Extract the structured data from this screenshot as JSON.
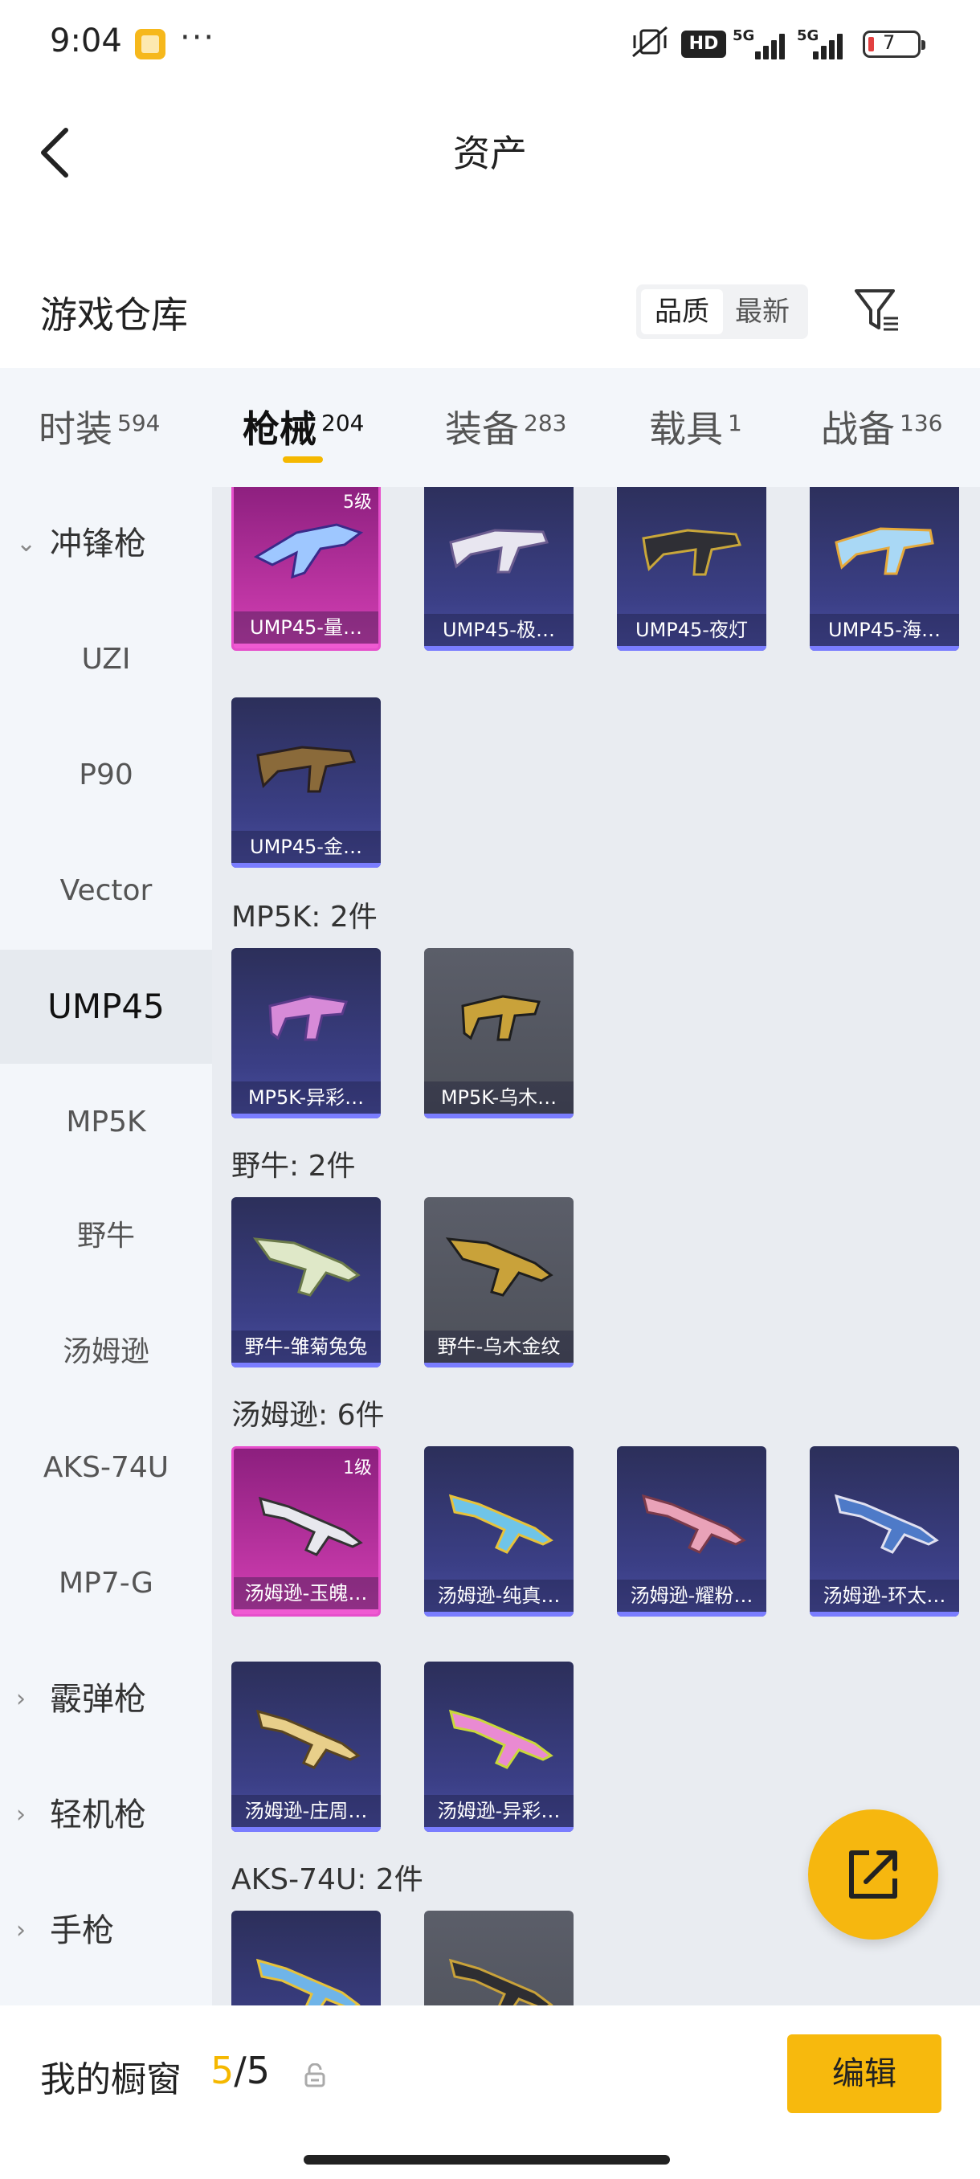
{
  "status_bar": {
    "time": "9:04",
    "battery": "7",
    "hd_label": "HD",
    "network1": "5G",
    "network2": "5G"
  },
  "header": {
    "title": "资产"
  },
  "warehouse": {
    "title": "游戏仓库",
    "sort_options": [
      "品质",
      "最新"
    ]
  },
  "tabs": [
    {
      "label": "时装",
      "count": "594"
    },
    {
      "label": "枪械",
      "count": "204"
    },
    {
      "label": "装备",
      "count": "283"
    },
    {
      "label": "载具",
      "count": "1"
    },
    {
      "label": "战备",
      "count": "136"
    }
  ],
  "sidebar": [
    {
      "label": "冲锋枪",
      "type": "group",
      "expanded": true
    },
    {
      "label": "UZI"
    },
    {
      "label": "P90"
    },
    {
      "label": "Vector"
    },
    {
      "label": "UMP45",
      "selected": true
    },
    {
      "label": "MP5K"
    },
    {
      "label": "野牛"
    },
    {
      "label": "汤姆逊"
    },
    {
      "label": "AKS-74U"
    },
    {
      "label": "MP7-G"
    },
    {
      "label": "霰弹枪",
      "type": "group"
    },
    {
      "label": "轻机枪",
      "type": "group"
    },
    {
      "label": "手枪",
      "type": "group"
    }
  ],
  "sections": {
    "mp5k_title": "MP5K: 2件",
    "yeniu_title": "野牛: 2件",
    "tommy_title": "汤姆逊: 6件",
    "aks_title": "AKS-74U: 2件"
  },
  "cards": {
    "ump1": {
      "name": "UMP45-量…",
      "level": "5级"
    },
    "ump2": {
      "name": "UMP45-极…"
    },
    "ump3": {
      "name": "UMP45-夜灯"
    },
    "ump4": {
      "name": "UMP45-海…"
    },
    "ump5": {
      "name": "UMP45-金…"
    },
    "mp5k1": {
      "name": "MP5K-异彩…"
    },
    "mp5k2": {
      "name": "MP5K-乌木…"
    },
    "yn1": {
      "name": "野牛-雏菊兔兔"
    },
    "yn2": {
      "name": "野牛-乌木金纹"
    },
    "tm1": {
      "name": "汤姆逊-玉魄…",
      "level": "1级"
    },
    "tm2": {
      "name": "汤姆逊-纯真…"
    },
    "tm3": {
      "name": "汤姆逊-耀粉…"
    },
    "tm4": {
      "name": "汤姆逊-环太…"
    },
    "tm5": {
      "name": "汤姆逊-庄周…"
    },
    "tm6": {
      "name": "汤姆逊-异彩…"
    }
  },
  "bottom_bar": {
    "label": "我的橱窗",
    "current": "5",
    "total": "/5",
    "edit_label": "编辑"
  },
  "colors": {
    "accent": "#f5b800",
    "card_blue": "#3b3f86",
    "card_pink": "#d43fb4",
    "card_gray": "#5b5e69"
  }
}
